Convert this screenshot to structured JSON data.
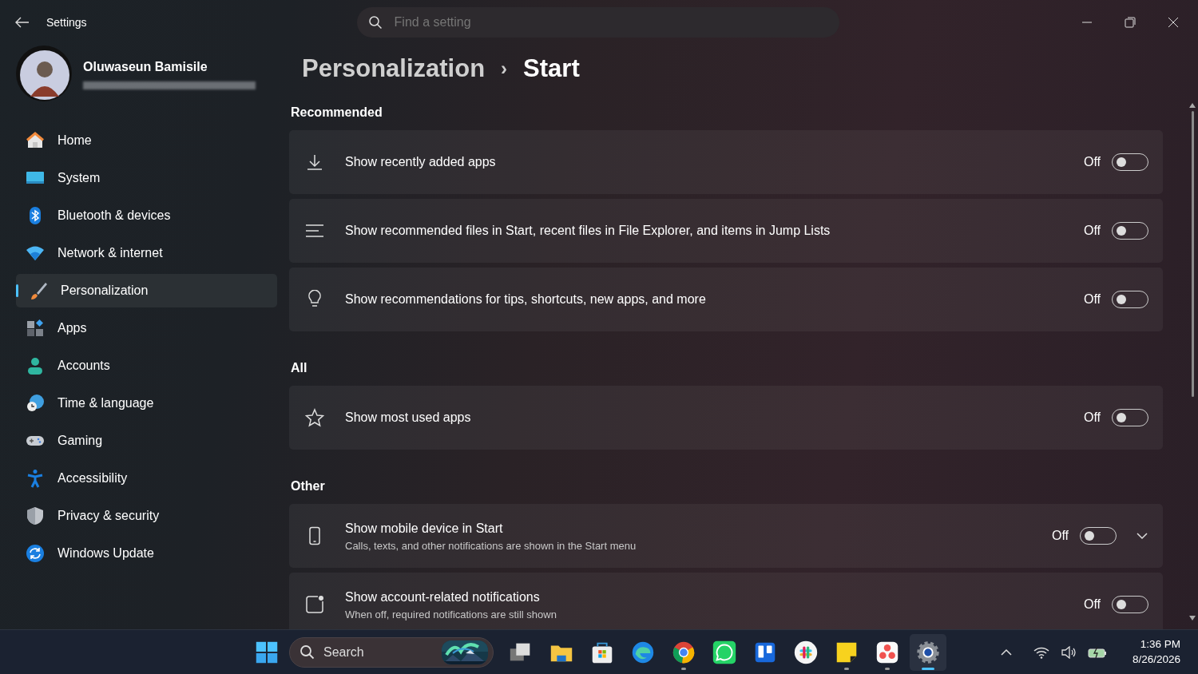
{
  "window": {
    "title": "Settings"
  },
  "search": {
    "placeholder": "Find a setting"
  },
  "user": {
    "name": "Oluwaseun Bamisile"
  },
  "sidebar": {
    "items": [
      {
        "label": "Home",
        "selected": false
      },
      {
        "label": "System",
        "selected": false
      },
      {
        "label": "Bluetooth & devices",
        "selected": false
      },
      {
        "label": "Network & internet",
        "selected": false
      },
      {
        "label": "Personalization",
        "selected": true
      },
      {
        "label": "Apps",
        "selected": false
      },
      {
        "label": "Accounts",
        "selected": false
      },
      {
        "label": "Time & language",
        "selected": false
      },
      {
        "label": "Gaming",
        "selected": false
      },
      {
        "label": "Accessibility",
        "selected": false
      },
      {
        "label": "Privacy & security",
        "selected": false
      },
      {
        "label": "Windows Update",
        "selected": false
      }
    ]
  },
  "breadcrumb": {
    "parent": "Personalization",
    "separator": "›",
    "current": "Start"
  },
  "sections": [
    {
      "title": "Recommended",
      "settings": [
        {
          "label": "Show recently added apps",
          "state_text": "Off",
          "on": false
        },
        {
          "label": "Show recommended files in Start, recent files in File Explorer, and items in Jump Lists",
          "state_text": "Off",
          "on": false
        },
        {
          "label": "Show recommendations for tips, shortcuts, new apps, and more",
          "state_text": "Off",
          "on": false
        }
      ]
    },
    {
      "title": "All",
      "settings": [
        {
          "label": "Show most used apps",
          "state_text": "Off",
          "on": false
        }
      ]
    },
    {
      "title": "Other",
      "settings": [
        {
          "label": "Show mobile device in Start",
          "description": "Calls, texts, and other notifications are shown in the Start menu",
          "state_text": "Off",
          "on": false,
          "expandable": true
        },
        {
          "label": "Show account-related notifications",
          "description": "When off, required notifications are still shown",
          "state_text": "Off",
          "on": false
        }
      ]
    }
  ],
  "taskbar": {
    "search_label": "Search",
    "apps": [
      {
        "running": false,
        "active": false
      },
      {
        "running": false,
        "active": false
      },
      {
        "running": false,
        "active": false
      },
      {
        "running": false,
        "active": false
      },
      {
        "running": true,
        "active": false
      },
      {
        "running": false,
        "active": false
      },
      {
        "running": false,
        "active": false
      },
      {
        "running": false,
        "active": false
      },
      {
        "running": true,
        "active": false
      },
      {
        "running": true,
        "active": false
      },
      {
        "running": true,
        "active": true
      }
    ],
    "time": "1:36 PM",
    "date": "8/26/2026"
  }
}
